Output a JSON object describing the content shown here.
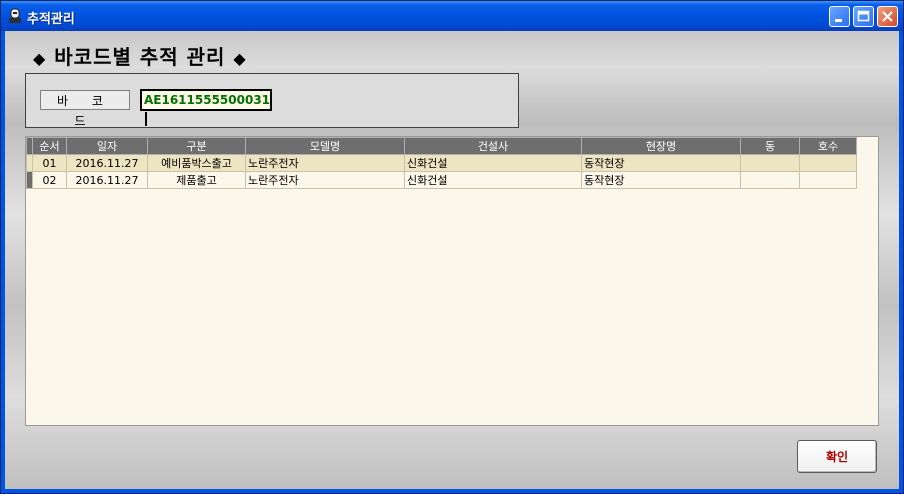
{
  "window": {
    "title": "추적관리"
  },
  "heading": {
    "left_mark": "◆",
    "text": "바코드별 추적 관리",
    "right_mark": "◆"
  },
  "barcode": {
    "label": "바 코 드",
    "value": "AE1611555500031"
  },
  "grid": {
    "columns": [
      "순서",
      "일자",
      "구분",
      "모델명",
      "건설사",
      "현장명",
      "동",
      "호수"
    ],
    "rows": [
      [
        "01",
        "2016.11.27",
        "예비품박스출고",
        "노란주전자",
        "신화건설",
        "동작현장",
        "",
        ""
      ],
      [
        "02",
        "2016.11.27",
        "제품출고",
        "노란주전자",
        "신화건설",
        "동작현장",
        "",
        ""
      ]
    ]
  },
  "buttons": {
    "ok": "확인"
  }
}
